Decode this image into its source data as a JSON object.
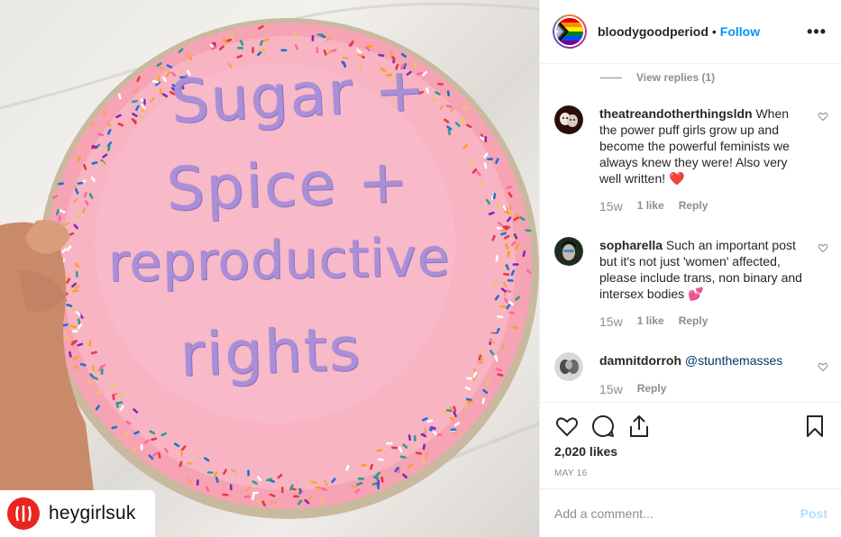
{
  "photo": {
    "cake_lines": [
      "Sugar +",
      "Spice +",
      "reproductive",
      "rights"
    ],
    "repost_handle": "heygirlsuk",
    "colors": {
      "frosting": "#f59fb0",
      "icing": "#a98fd8",
      "repost_logo": "#e8261f"
    }
  },
  "header": {
    "username": "bloodygoodperiod",
    "separator": "•",
    "follow_label": "Follow",
    "more_label": "•••"
  },
  "comments": {
    "view_replies": "View replies (1)",
    "items": [
      {
        "user": "theatreandotherthingsldn",
        "text": "When the power puff girls grow up and become the powerful feminists we always knew they were! Also very well written! ❤️",
        "time": "15w",
        "likes": "1 like",
        "reply": "Reply"
      },
      {
        "user": "sopharella",
        "text": "Such an important post but it's not just 'women' affected, please include trans, non binary and intersex bodies 💕",
        "time": "15w",
        "likes": "1 like",
        "reply": "Reply"
      },
      {
        "user": "damnitdorroh",
        "text": "@stunthemasses",
        "time": "15w",
        "reply": "Reply"
      }
    ]
  },
  "actions": {
    "likes": "2,020 likes",
    "date": "MAY 16"
  },
  "add_comment": {
    "placeholder": "Add a comment...",
    "post_label": "Post"
  },
  "colors": {
    "link_blue": "#0095f6",
    "muted": "#8e8e8e",
    "text": "#262626",
    "post_disabled": "#b2dffc"
  }
}
